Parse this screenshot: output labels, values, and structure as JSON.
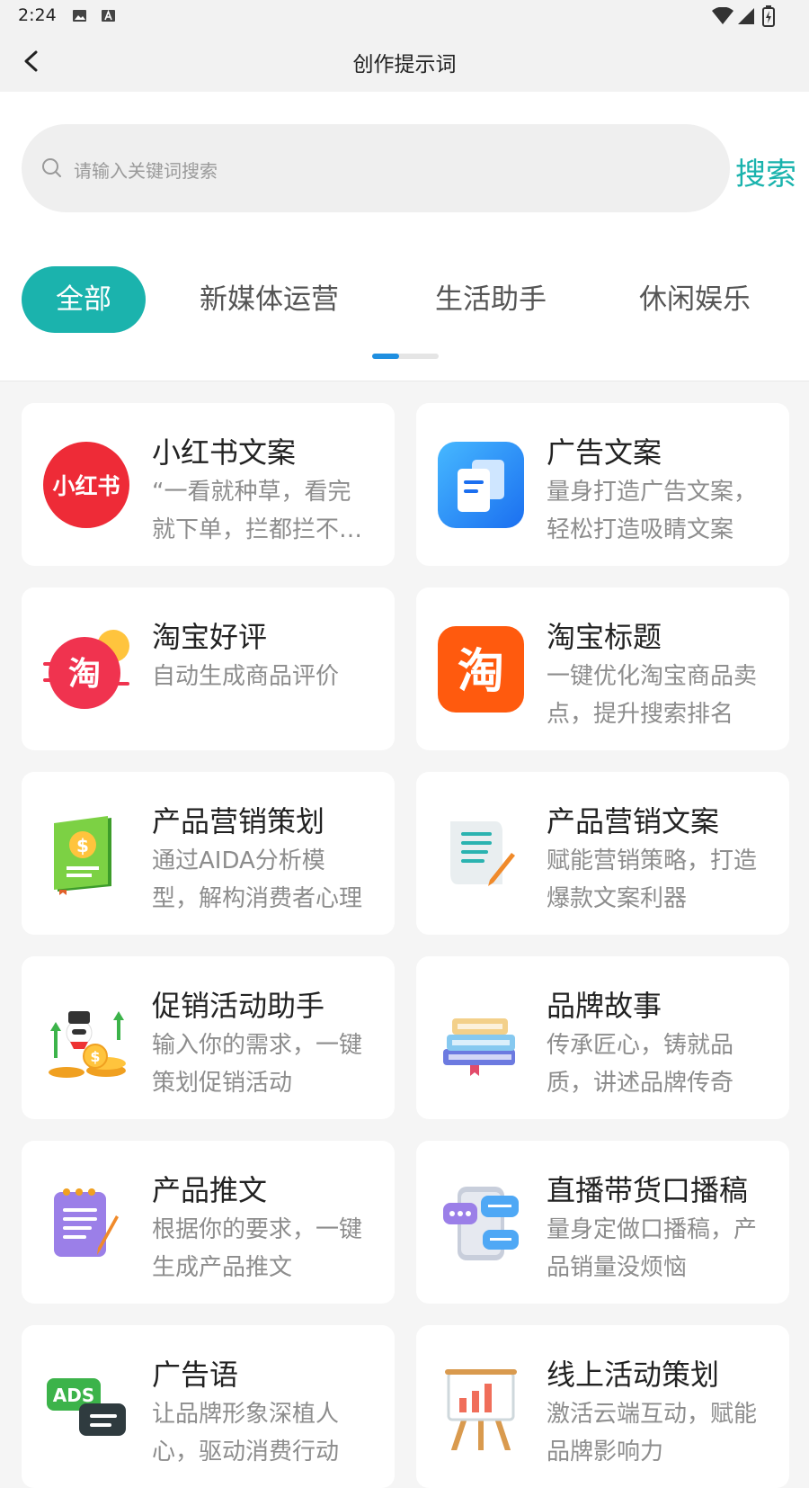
{
  "status": {
    "time": "2:24"
  },
  "header": {
    "title": "创作提示词"
  },
  "search": {
    "placeholder": "请输入关键词搜索",
    "button": "搜索"
  },
  "tabs": [
    {
      "label": "全部"
    },
    {
      "label": "新媒体运营"
    },
    {
      "label": "生活助手"
    },
    {
      "label": "休闲娱乐"
    }
  ],
  "cards": [
    {
      "title": "小红书文案",
      "desc": "“一看就种草，看完就下单，拦都拦不住”",
      "icon": "xiaohongshu-icon"
    },
    {
      "title": "广告文案",
      "desc": "量身打造广告文案，轻松打造吸睛文案",
      "icon": "document-icon"
    },
    {
      "title": "淘宝好评",
      "desc": "自动生成商品评价",
      "icon": "taobao-review-icon"
    },
    {
      "title": "淘宝标题",
      "desc": "一键优化淘宝商品卖点，提升搜索排名",
      "icon": "taobao-icon"
    },
    {
      "title": "产品营销策划",
      "desc": "通过AIDA分析模型，解构消费者心理",
      "icon": "money-book-icon"
    },
    {
      "title": "产品营销文案",
      "desc": "赋能营销策略，打造爆款文案利器",
      "icon": "scroll-pen-icon"
    },
    {
      "title": "促销活动助手",
      "desc": "输入你的需求，一键策划促销活动",
      "icon": "coins-snowman-icon"
    },
    {
      "title": "品牌故事",
      "desc": "传承匠心，铸就品质，讲述品牌传奇",
      "icon": "books-icon"
    },
    {
      "title": "产品推文",
      "desc": "根据你的要求，一键生成产品推文",
      "icon": "notepad-icon"
    },
    {
      "title": "直播带货口播稿",
      "desc": "量身定做口播稿，产品销量没烦恼",
      "icon": "phone-chat-icon"
    },
    {
      "title": "广告语",
      "desc": "让品牌形象深植人心，驱动消费行动",
      "icon": "ads-icon"
    },
    {
      "title": "线上活动策划",
      "desc": "激活云端互动，赋能品牌影响力",
      "icon": "easel-chart-icon"
    }
  ],
  "colors": {
    "accent": "#1bb3ad",
    "indicator": "#1f8fe0"
  }
}
